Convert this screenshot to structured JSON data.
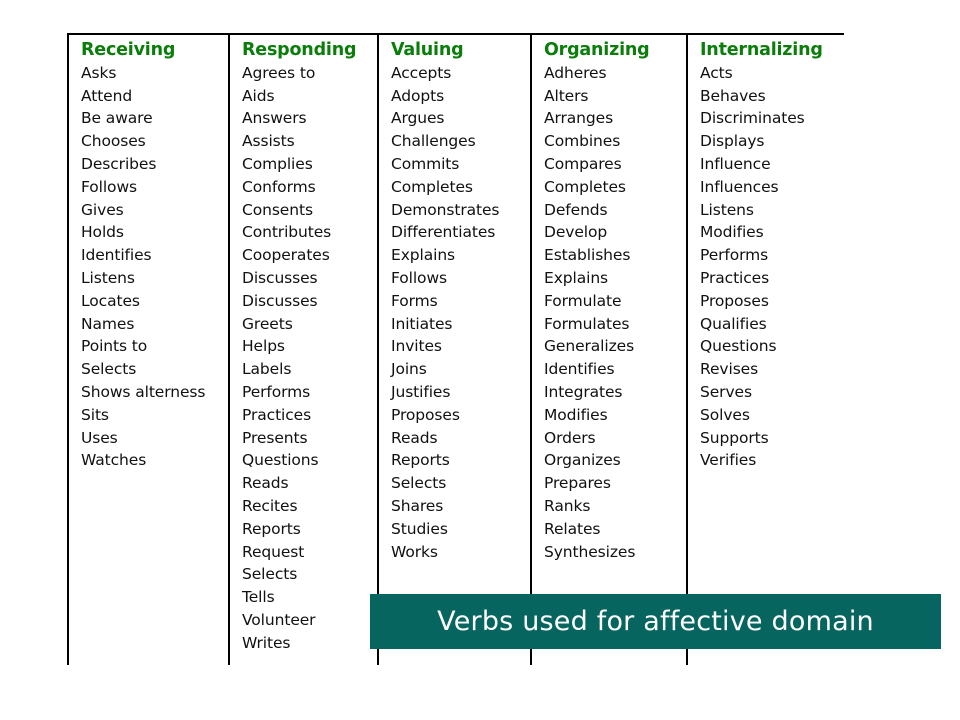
{
  "slide": {
    "background_color": "#ffffff",
    "header_color": "#0a7d0a",
    "text_color": "#111111",
    "banner_color": "#07655f",
    "banner_text_color": "#ffffff"
  },
  "caption": {
    "text": "Verbs used for affective domain"
  },
  "table": {
    "columns": [
      {
        "header": "Receiving",
        "verbs": [
          "Asks",
          "Attend",
          "Be aware",
          "Chooses",
          "Describes",
          "Follows",
          "Gives",
          "Holds",
          "Identifies",
          "Listens",
          "Locates",
          "Names",
          "Points to",
          "Selects",
          "Shows alterness",
          "Sits",
          "Uses",
          "Watches"
        ]
      },
      {
        "header": "Responding",
        "verbs": [
          "Agrees to",
          "Aids",
          "Answers",
          "Assists",
          "Complies",
          "Conforms",
          "Consents",
          "Contributes",
          "Cooperates",
          "Discusses",
          "Discusses",
          "Greets",
          "Helps",
          "Labels",
          "Performs",
          "Practices",
          "Presents",
          "Questions",
          "Reads",
          "Recites",
          "Reports",
          "Request",
          "Selects",
          "Tells",
          "Volunteer",
          "Writes"
        ]
      },
      {
        "header": "Valuing",
        "verbs": [
          "Accepts",
          "Adopts",
          "Argues",
          "Challenges",
          "Commits",
          "Completes",
          "Demonstrates",
          "Differentiates",
          "Explains",
          "Follows",
          "Forms",
          "Initiates",
          "Invites",
          "Joins",
          "Justifies",
          "Proposes",
          "Reads",
          "Reports",
          "Selects",
          "Shares",
          "Studies",
          "Works"
        ]
      },
      {
        "header": "Organizing",
        "verbs": [
          "Adheres",
          "Alters",
          "Arranges",
          "Combines",
          "Compares",
          "Completes",
          "Defends",
          "Develop",
          "Establishes",
          "Explains",
          "Formulate",
          "Formulates",
          "Generalizes",
          "Identifies",
          "Integrates",
          "Modifies",
          "Orders",
          "Organizes",
          "Prepares",
          "Ranks",
          "Relates",
          "Synthesizes"
        ]
      },
      {
        "header": "Internalizing",
        "verbs": [
          "Acts",
          "Behaves",
          "Discriminates",
          "Displays",
          "Influence",
          "Influences",
          "Listens",
          "Modifies",
          "Performs",
          "Practices",
          "Proposes",
          "Qualifies",
          "Questions",
          "Revises",
          "Serves",
          "Solves",
          "Supports",
          "Verifies"
        ]
      }
    ]
  }
}
